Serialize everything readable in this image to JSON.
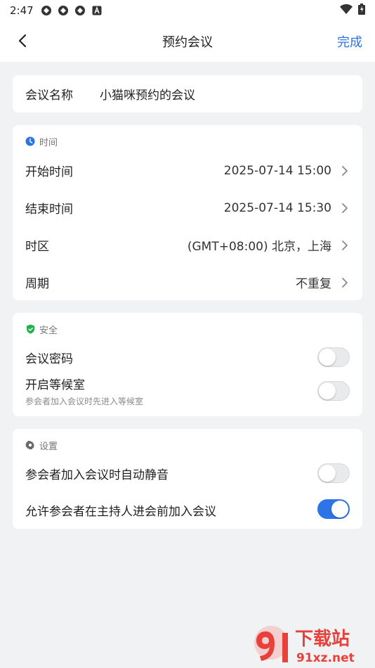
{
  "status_bar": {
    "time": "2:47"
  },
  "nav": {
    "title": "预约会议",
    "done_label": "完成"
  },
  "meeting_name": {
    "label": "会议名称",
    "value": "小猫咪预约的会议"
  },
  "time_section": {
    "header": "时间",
    "rows": [
      {
        "label": "开始时间",
        "value": "2025-07-14 15:00"
      },
      {
        "label": "结束时间",
        "value": "2025-07-14 15:30"
      },
      {
        "label": "时区",
        "value": "(GMT+08:00) 北京，上海"
      },
      {
        "label": "周期",
        "value": "不重复"
      }
    ]
  },
  "security_section": {
    "header": "安全",
    "password": {
      "label": "会议密码",
      "enabled": false
    },
    "waiting_room": {
      "label": "开启等候室",
      "sublabel": "参会者加入会议时先进入等候室",
      "enabled": false
    }
  },
  "settings_section": {
    "header": "设置",
    "auto_mute": {
      "label": "参会者加入会议时自动静音",
      "enabled": false
    },
    "join_before_host": {
      "label": "允许参会者在主持人进会前加入会议",
      "enabled": true
    }
  },
  "watermark": {
    "brand": "下载站",
    "site": "91xz.net"
  },
  "colors": {
    "accent": "#2e74e6",
    "security_green": "#21b14b",
    "background": "#f1f2f4",
    "watermark_red": "#e8413c"
  }
}
